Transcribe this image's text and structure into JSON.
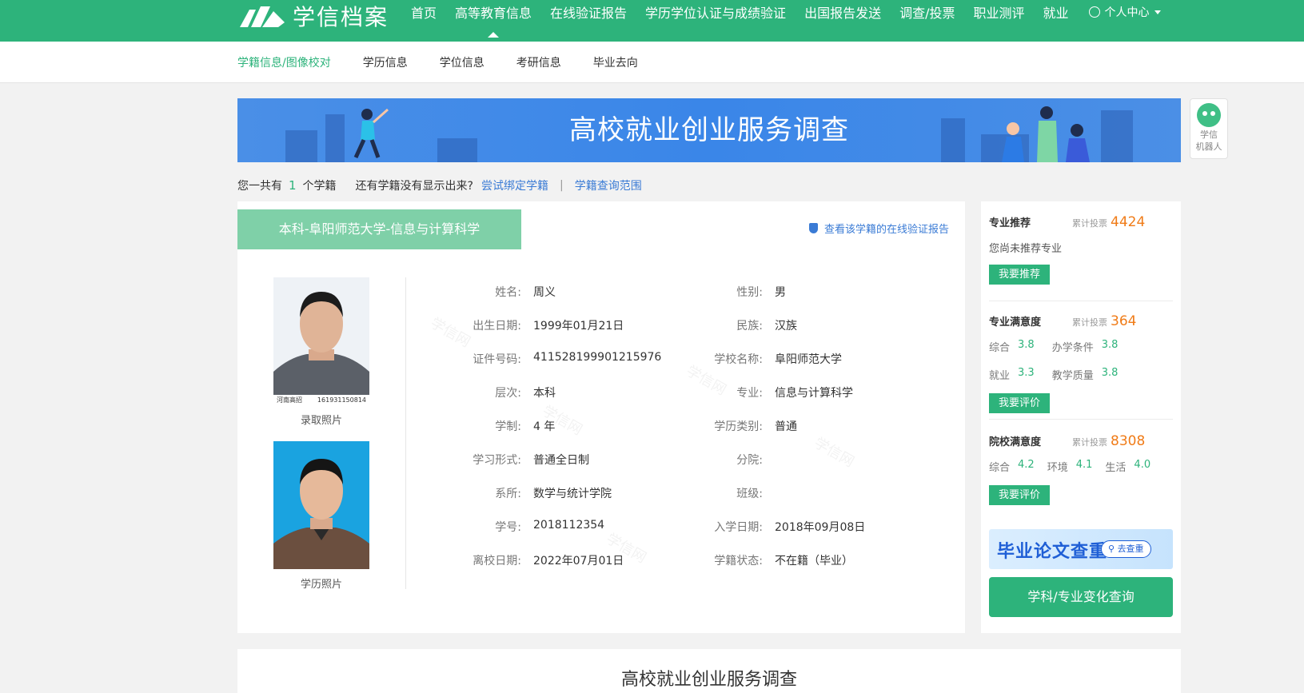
{
  "brand": {
    "name": "学信档案"
  },
  "nav": {
    "items": [
      "首页",
      "高等教育信息",
      "在线验证报告",
      "学历学位认证与成绩验证",
      "出国报告发送",
      "调查/投票",
      "职业测评",
      "就业"
    ],
    "user_center": "个人中心"
  },
  "subnav": {
    "items": [
      "学籍信息/图像校对",
      "学历信息",
      "学位信息",
      "考研信息",
      "毕业去向"
    ]
  },
  "banner": {
    "title": "高校就业创业服务调查"
  },
  "robot": {
    "label_line1": "学信",
    "label_line2": "机器人"
  },
  "countline": {
    "prefix": "您一共有",
    "count": "1",
    "suffix": "个学籍",
    "question": "还有学籍没有显示出来?",
    "bind_link": "尝试绑定学籍",
    "separator": "|",
    "scope_link": "学籍查询范围"
  },
  "record": {
    "school_tag": "本科-阜阳师范大学-信息与计算科学",
    "verify_link": "查看该学籍的在线验证报告",
    "photo1_caption": "录取照片",
    "photo1_id_left": "河南高招2018",
    "photo1_id_right": "161931150814",
    "photo2_caption": "学历照片",
    "left_fields": [
      {
        "label": "姓名:",
        "value": "周义"
      },
      {
        "label": "出生日期:",
        "value": "1999年01月21日"
      },
      {
        "label": "证件号码:",
        "value": "411528199901215976"
      },
      {
        "label": "层次:",
        "value": "本科"
      },
      {
        "label": "学制:",
        "value": "4 年"
      },
      {
        "label": "学习形式:",
        "value": "普通全日制"
      },
      {
        "label": "系所:",
        "value": "数学与统计学院"
      },
      {
        "label": "学号:",
        "value": "2018112354"
      },
      {
        "label": "离校日期:",
        "value": "2022年07月01日"
      }
    ],
    "right_fields": [
      {
        "label": "性别:",
        "value": "男"
      },
      {
        "label": "民族:",
        "value": "汉族"
      },
      {
        "label": "学校名称:",
        "value": "阜阳师范大学"
      },
      {
        "label": "专业:",
        "value": "信息与计算科学"
      },
      {
        "label": "学历类别:",
        "value": "普通"
      },
      {
        "label": "分院:",
        "value": ""
      },
      {
        "label": "班级:",
        "value": ""
      },
      {
        "label": "入学日期:",
        "value": "2018年09月08日"
      },
      {
        "label": "学籍状态:",
        "value": "不在籍（毕业）"
      }
    ],
    "watermark": "学信网"
  },
  "sidebar": {
    "major_recommend": {
      "title": "专业推荐",
      "votes_label": "累计投票",
      "votes": "4424",
      "empty_text": "您尚未推荐专业",
      "button": "我要推荐"
    },
    "major_satisfaction": {
      "title": "专业满意度",
      "votes_label": "累计投票",
      "votes": "364",
      "ratings_row1": [
        {
          "name": "综合",
          "value": "3.8"
        },
        {
          "name": "办学条件",
          "value": "3.8"
        }
      ],
      "ratings_row2": [
        {
          "name": "就业",
          "value": "3.3"
        },
        {
          "name": "教学质量",
          "value": "3.8"
        }
      ],
      "button": "我要评价"
    },
    "school_satisfaction": {
      "title": "院校满意度",
      "votes_label": "累计投票",
      "votes": "8308",
      "ratings": [
        {
          "name": "综合",
          "value": "4.2"
        },
        {
          "name": "环境",
          "value": "4.1"
        },
        {
          "name": "生活",
          "value": "4.0"
        }
      ],
      "button": "我要评价"
    },
    "thesis": {
      "title": "毕业论文查重",
      "button": "去查重"
    },
    "major_change_button": "学科/专业变化查询"
  },
  "bottom_card": {
    "title": "高校就业创业服务调查"
  },
  "colors": {
    "brand_green": "#2db37b",
    "link_blue": "#3a7bd5",
    "count_orange": "#f07b17"
  }
}
